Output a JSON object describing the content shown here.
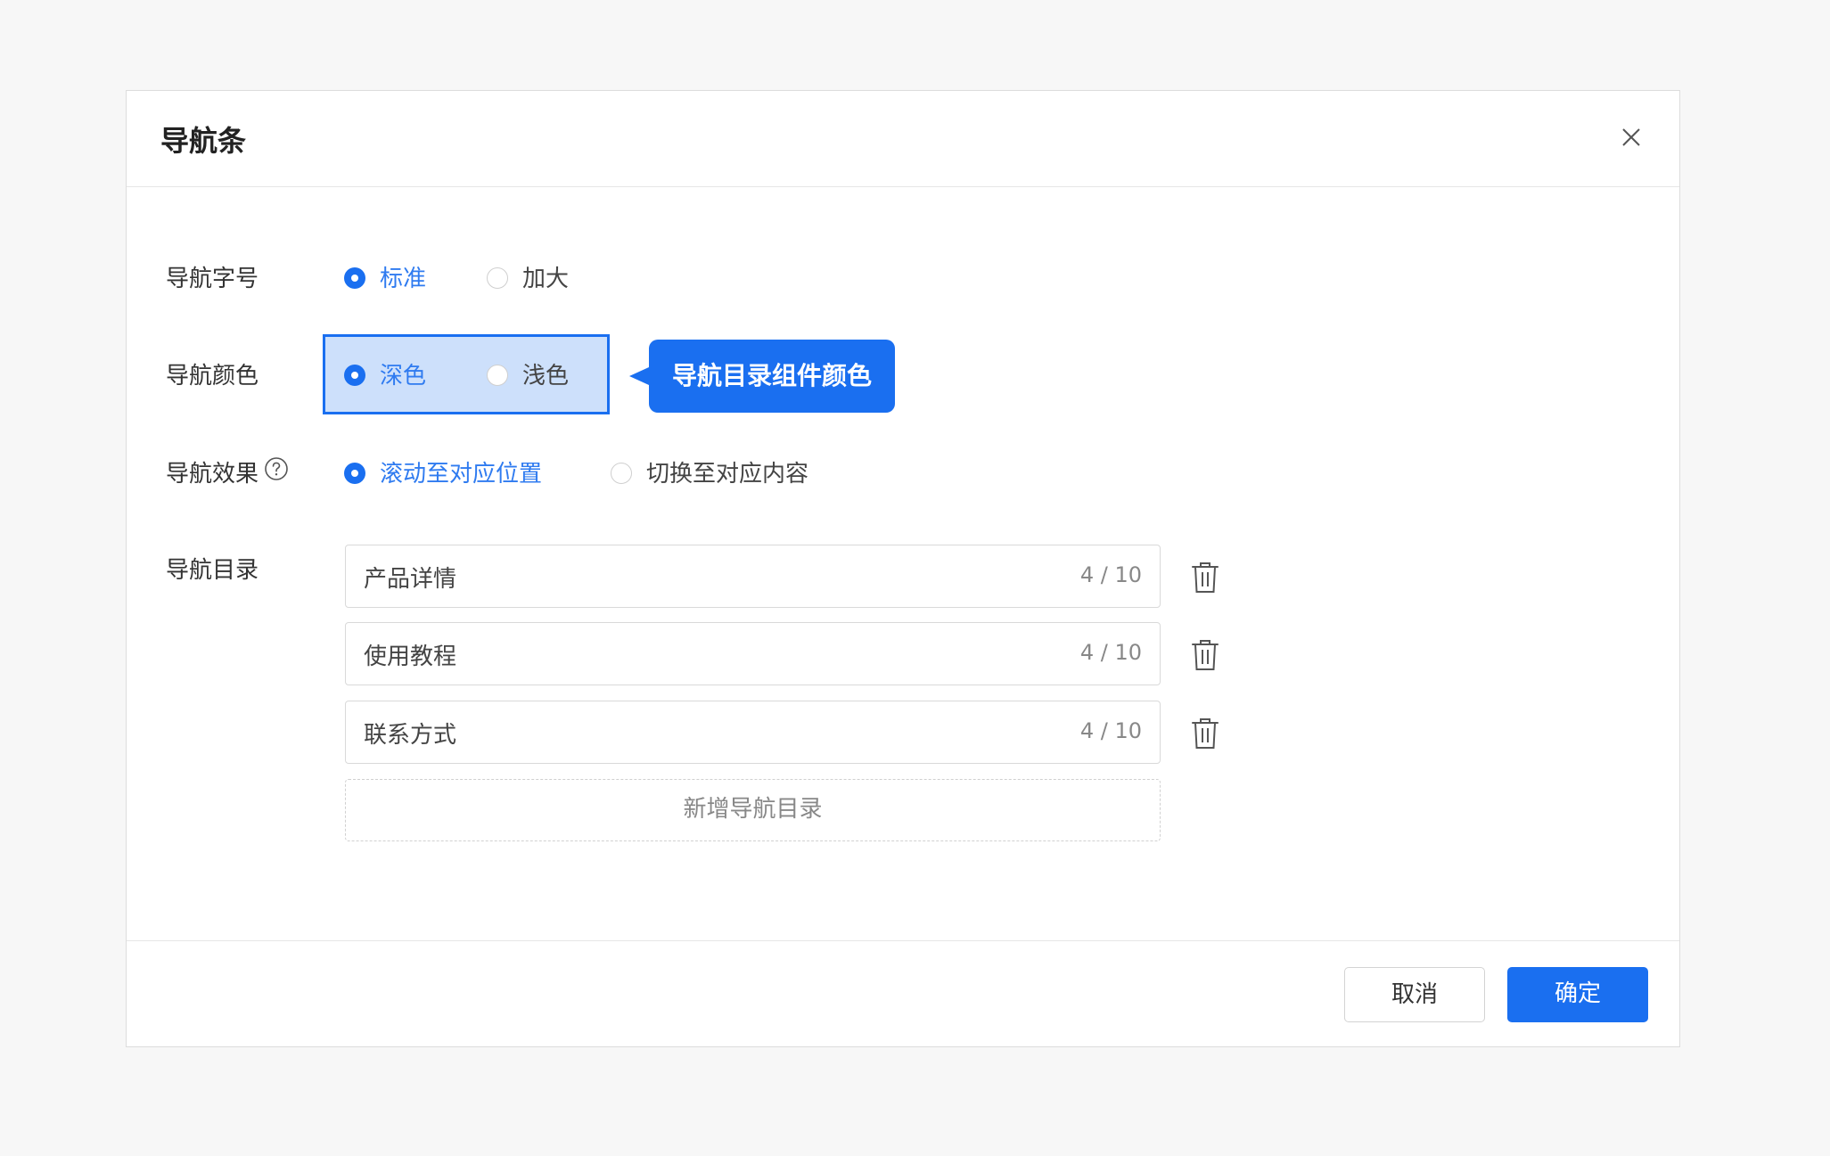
{
  "dialog": {
    "title": "导航条",
    "close_icon": "close-icon"
  },
  "font_size": {
    "label": "导航字号",
    "options": [
      {
        "label": "标准",
        "checked": true
      },
      {
        "label": "加大",
        "checked": false
      }
    ]
  },
  "color": {
    "label": "导航颜色",
    "options": [
      {
        "label": "深色",
        "checked": true
      },
      {
        "label": "浅色",
        "checked": false
      }
    ],
    "callout": "导航目录组件颜色",
    "highlight_color": "#1a6ff0"
  },
  "effect": {
    "label": "导航效果",
    "help_icon": "question-circle-icon",
    "options": [
      {
        "label": "滚动至对应位置",
        "checked": true
      },
      {
        "label": "切换至对应内容",
        "checked": false
      }
    ]
  },
  "directory": {
    "label": "导航目录",
    "items": [
      {
        "value": "产品详情",
        "count": "4 / 10"
      },
      {
        "value": "使用教程",
        "count": "4 / 10"
      },
      {
        "value": "联系方式",
        "count": "4 / 10"
      }
    ],
    "delete_icon": "trash-icon",
    "add_label": "新增导航目录"
  },
  "footer": {
    "cancel_label": "取消",
    "ok_label": "确定"
  },
  "colors": {
    "primary": "#1a6ff0",
    "background": "#f7f7f7"
  }
}
